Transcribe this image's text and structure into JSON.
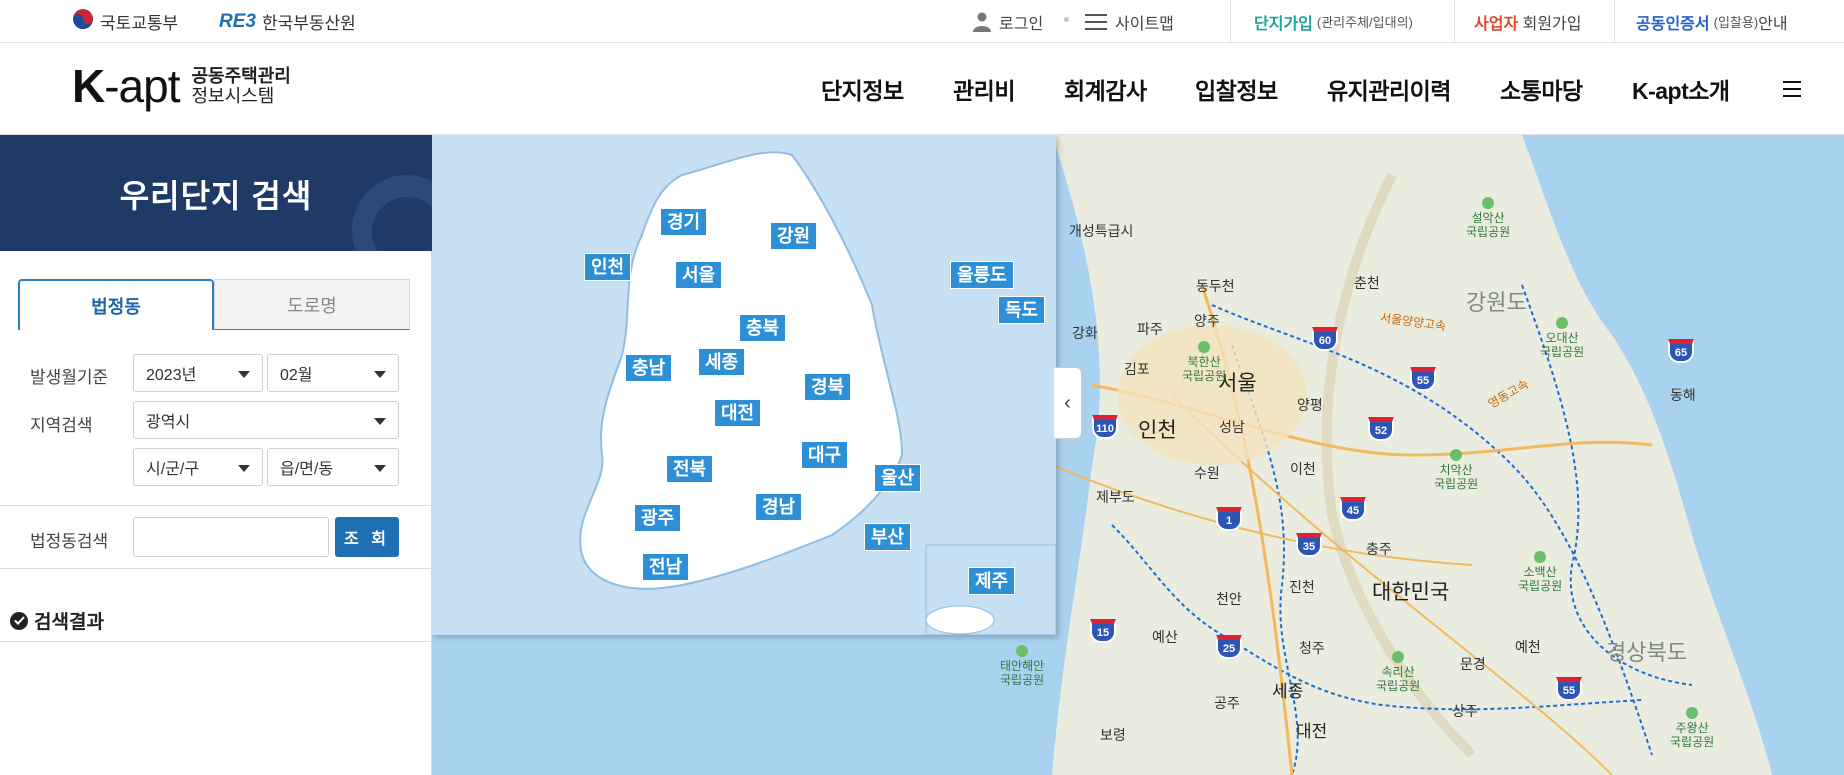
{
  "topbar": {
    "org1": "국토교통부",
    "org2_mark": "RE3",
    "org2": "한국부동산원",
    "login": "로그인",
    "sitemap": "사이트맵",
    "link1_main": "단지가입",
    "link1_sub": "(관리주체/입대의)",
    "link2_main": "사업자",
    "link2_rest": " 회원가입",
    "link3_main": "공동인증서",
    "link3_sub": "(입찰용)",
    "link3_rest": "안내",
    "colors": {
      "link1": "#1aa39b",
      "link2": "#e0492b",
      "link3": "#2563c9"
    }
  },
  "header": {
    "logo_k": "K",
    "logo_apt": "-apt",
    "logo_line1": "공동주택관리",
    "logo_line2": "정보시스템",
    "nav": [
      "단지정보",
      "관리비",
      "회계감사",
      "입찰정보",
      "유지관리이력",
      "소통마당",
      "K-apt소개"
    ],
    "menu_icon": "hamburger-icon"
  },
  "sidebar": {
    "title": "우리단지 검색",
    "tab_active": "법정동",
    "tab_inactive": "도로명",
    "label_period": "발생월기준",
    "year": "2023년",
    "month": "02월",
    "label_region": "지역검색",
    "region1": "광역시",
    "region2": "시/군/구",
    "region3": "읍/면/동",
    "label_dong_search": "법정동검색",
    "dong_search_value": "",
    "search_button": "조 회",
    "result_title": "검색결과"
  },
  "overview_map": {
    "regions": {
      "gyeonggi": "경기",
      "gangwon": "강원",
      "incheon": "인천",
      "seoul": "서울",
      "ulleungdo": "울릉도",
      "dokdo": "독도",
      "chungbuk": "충북",
      "chungnam": "충남",
      "sejong": "세종",
      "gyeongbuk": "경북",
      "daejeon": "대전",
      "daegu": "대구",
      "jeonbuk": "전북",
      "ulsan": "울산",
      "gwangju": "광주",
      "gyeongnam": "경남",
      "busan": "부산",
      "jeonnam": "전남",
      "jeju": "제주"
    },
    "collapse_icon": "chevron-left-icon"
  },
  "base_map": {
    "cities": {
      "kaesong": "개성특급시",
      "dongducheon": "동두천",
      "chuncheon": "춘천",
      "ganghwa": "강화",
      "paju": "파주",
      "yangju": "양주",
      "gimpo": "김포",
      "seoul": "서울",
      "incheon": "인천",
      "seongnam": "성남",
      "yangpyeong": "양평",
      "suwon": "수원",
      "icheon": "이천",
      "jebudo": "제부도",
      "chungju": "충주",
      "jincheon": "진천",
      "cheonan": "천안",
      "yesan": "예산",
      "cheongju": "청주",
      "mungyeong": "문경",
      "yecheon": "예천",
      "sejong": "세종",
      "gongju": "공주",
      "sangju": "상주",
      "boryeong": "보령",
      "daejeon": "대전",
      "donghae": "동해"
    },
    "country": "대한민국",
    "provinces": {
      "gangwon": "강원도",
      "gyeongbuk": "경상북도"
    },
    "parks": {
      "seorak": [
        "설악산",
        "국립공원"
      ],
      "bukhan": [
        "북한산",
        "국립공원"
      ],
      "odae": [
        "오대산",
        "국립공원"
      ],
      "chiak": [
        "치악산",
        "국립공원"
      ],
      "sobaek": [
        "소백산",
        "국립공원"
      ],
      "songni": [
        "속리산",
        "국립공원"
      ],
      "juwang": [
        "주왕산",
        "국립공원"
      ],
      "taean": [
        "태안해안",
        "국립공원"
      ]
    },
    "roads": {
      "seoul_yangyang": "서울양양고속",
      "yeongdong": "영동고속"
    },
    "route_shields": [
      "60",
      "65",
      "55",
      "110",
      "52",
      "45",
      "1",
      "35",
      "15",
      "25",
      "55"
    ]
  }
}
